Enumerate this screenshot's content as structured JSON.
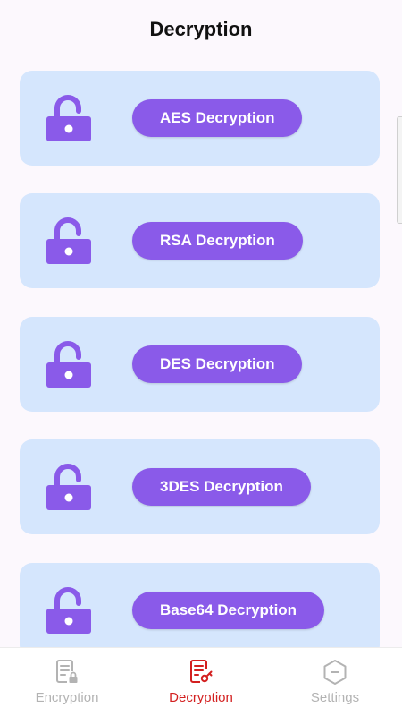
{
  "header": {
    "title": "Decryption"
  },
  "cards": [
    {
      "button_label": "AES Decryption",
      "icon": "unlock-icon"
    },
    {
      "button_label": "RSA Decryption",
      "icon": "unlock-icon"
    },
    {
      "button_label": "DES Decryption",
      "icon": "unlock-icon"
    },
    {
      "button_label": "3DES Decryption",
      "icon": "unlock-icon"
    },
    {
      "button_label": "Base64 Decryption",
      "icon": "unlock-icon"
    }
  ],
  "bottom_nav": {
    "items": [
      {
        "label": "Encryption",
        "icon": "encryption-document-icon",
        "active": false
      },
      {
        "label": "Decryption",
        "icon": "decryption-document-icon",
        "active": true
      },
      {
        "label": "Settings",
        "icon": "settings-hexagon-icon",
        "active": false
      }
    ]
  },
  "colors": {
    "background": "#fcf8fd",
    "card": "#d5e6fd",
    "accent": "#8a5ae9",
    "active_tab": "#d32020",
    "inactive_tab": "#b3b3b3"
  }
}
